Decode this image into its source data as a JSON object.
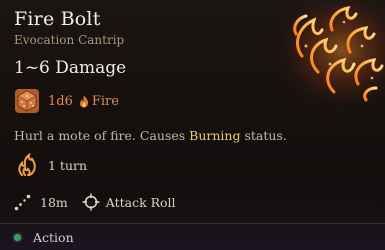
{
  "spell": {
    "name": "Fire Bolt",
    "school": "Evocation Cantrip",
    "damage_range": "1~6 Damage",
    "damage_dice": "1d6",
    "damage_type": "Fire",
    "description_before": "Hurl a mote of fire. Causes ",
    "description_keyword": "Burning",
    "description_after": " status.",
    "duration": "1 turn",
    "range": "18m",
    "roll_type": "Attack Roll",
    "cost": "Action"
  },
  "colors": {
    "fire_accent": "#e08a4a",
    "keyword": "#e6cf78",
    "action_dot": "#3f9a6b"
  },
  "icons": {
    "art": "fire-bolt-art-icon",
    "dice": "d6-dice-icon",
    "damage_type": "fire-icon",
    "duration": "burning-icon",
    "range": "range-icon",
    "roll": "crosshair-icon",
    "cost": "action-dot-icon"
  }
}
